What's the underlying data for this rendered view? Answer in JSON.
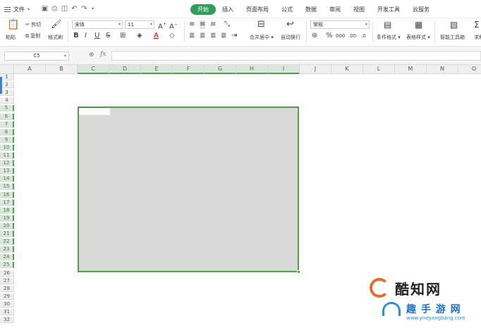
{
  "menu": {
    "file_label": "文件",
    "tabs": [
      {
        "label": "开始",
        "active": true
      },
      {
        "label": "插入"
      },
      {
        "label": "页面布局"
      },
      {
        "label": "公式"
      },
      {
        "label": "数据"
      },
      {
        "label": "审阅"
      },
      {
        "label": "视图"
      },
      {
        "label": "开发工具"
      },
      {
        "label": "云服务"
      }
    ]
  },
  "ribbon": {
    "paste": "粘贴",
    "cut": "剪切",
    "copy": "复制",
    "format_painter": "格式刷",
    "font_name": "宋体",
    "font_size": "11",
    "merge_center": "合并居中",
    "wrap_text": "自动换行",
    "number_format": "常规",
    "conditional_format": "条件格式",
    "table_style": "表格样式",
    "smart_toolbox": "智能工具箱",
    "truncated_next": "求和"
  },
  "formula_bar": {
    "cell_ref": "C5",
    "fx_label": "fx",
    "value": ""
  },
  "sheet": {
    "columns": [
      "A",
      "B",
      "C",
      "D",
      "E",
      "F",
      "G",
      "H",
      "I",
      "J",
      "K",
      "L",
      "M",
      "N",
      "O"
    ],
    "selected_columns": [
      "C",
      "D",
      "E",
      "F",
      "G",
      "H",
      "I"
    ],
    "rows": [
      "1",
      "2",
      "3",
      "4",
      "5",
      "6",
      "7",
      "8",
      "9",
      "10",
      "11",
      "12",
      "13",
      "14",
      "15",
      "16",
      "17",
      "18",
      "19",
      "20",
      "21",
      "22",
      "23",
      "24",
      "25",
      "26",
      "27",
      "28",
      "29",
      "30",
      "31",
      "32"
    ],
    "selected_rows": [
      "5",
      "6",
      "7",
      "8",
      "9",
      "10",
      "11",
      "12",
      "13",
      "14",
      "15",
      "16",
      "17",
      "18",
      "19",
      "20",
      "21",
      "22",
      "23",
      "24",
      "25"
    ],
    "selection_range": "C5:I25",
    "fill_color": "#d9d9d9",
    "selection_border_color": "#4ea24e"
  },
  "watermark": {
    "title": "酷知网",
    "subtitle": "趣  手  游  网",
    "url": "www.yneyangbang.com"
  },
  "colors": {
    "accent": "#2f9e57"
  }
}
